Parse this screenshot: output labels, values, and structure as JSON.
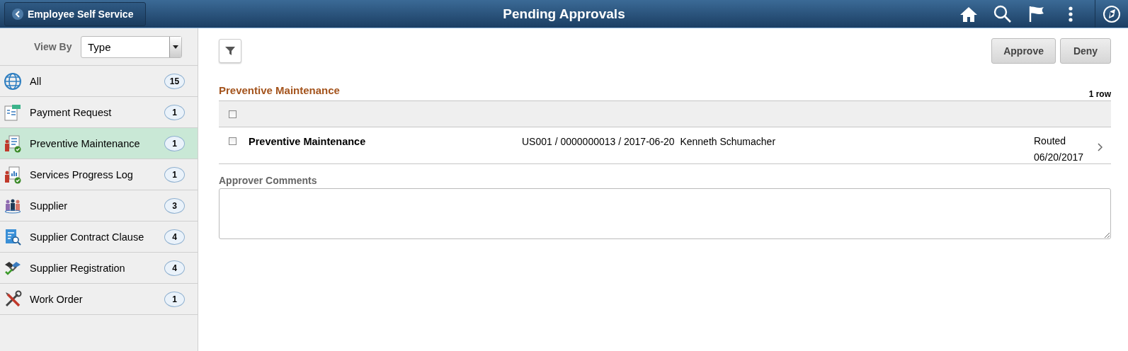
{
  "header": {
    "back_button": "Employee Self Service",
    "title": "Pending Approvals"
  },
  "sidebar": {
    "view_by_label": "View By",
    "view_by_value": "Type",
    "items": [
      {
        "label": "All",
        "count": "15",
        "selected": false
      },
      {
        "label": "Payment Request",
        "count": "1",
        "selected": false
      },
      {
        "label": "Preventive Maintenance",
        "count": "1",
        "selected": true
      },
      {
        "label": "Services Progress Log",
        "count": "1",
        "selected": false
      },
      {
        "label": "Supplier",
        "count": "3",
        "selected": false
      },
      {
        "label": "Supplier Contract Clause",
        "count": "4",
        "selected": false
      },
      {
        "label": "Supplier Registration",
        "count": "4",
        "selected": false
      },
      {
        "label": "Work Order",
        "count": "1",
        "selected": false
      }
    ]
  },
  "actions": [
    "Approve",
    "Deny"
  ],
  "section": {
    "title": "Preventive Maintenance",
    "row_count": "1 row",
    "select_all_checked": false,
    "rows": [
      {
        "checked": false,
        "type": "Preventive Maintenance",
        "details": "US001 / 0000000013 / 2017-06-20  Kenneth Schumacher",
        "status": "Routed",
        "date": "06/20/2017"
      }
    ]
  },
  "comments": {
    "label": "Approver Comments"
  }
}
